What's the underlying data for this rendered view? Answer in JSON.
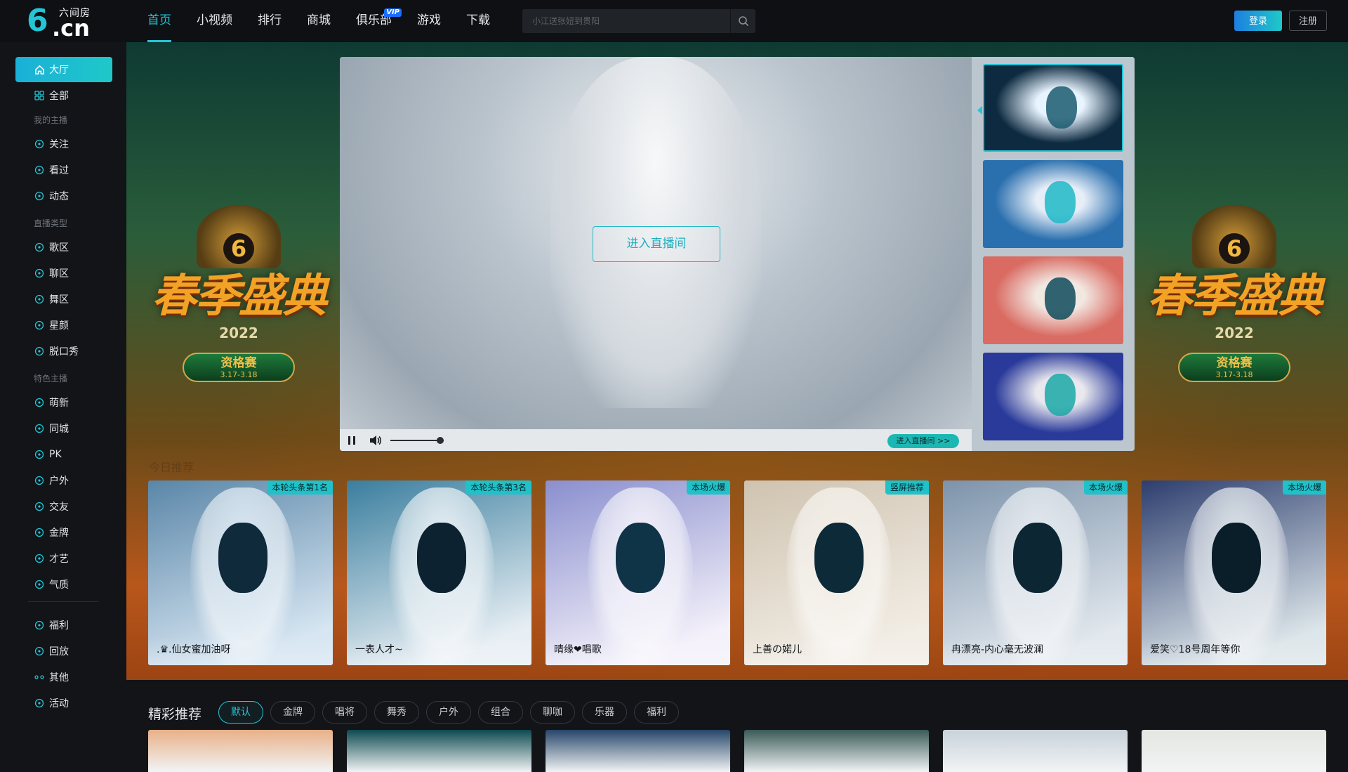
{
  "brand": {
    "glyph": "6",
    "domain": ".cn",
    "name": "六间房"
  },
  "nav": [
    {
      "label": "首页",
      "active": true
    },
    {
      "label": "小视频"
    },
    {
      "label": "排行"
    },
    {
      "label": "商城"
    },
    {
      "label": "俱乐部",
      "badge": "VIP"
    },
    {
      "label": "游戏"
    },
    {
      "label": "下载"
    }
  ],
  "search": {
    "placeholder": "小江送张妞到贵阳",
    "icon": "search-icon"
  },
  "auth": {
    "login": "登录",
    "register": "注册"
  },
  "sidebar": {
    "top": [
      {
        "label": "大厅",
        "icon": "home-icon",
        "active": true
      },
      {
        "label": "全部",
        "icon": "grid-icon"
      }
    ],
    "groups": [
      {
        "title": "我的主播",
        "items": [
          {
            "label": "关注",
            "icon": "heart-icon"
          },
          {
            "label": "看过",
            "icon": "clock-icon"
          },
          {
            "label": "动态",
            "icon": "chat-icon"
          }
        ]
      },
      {
        "title": "直播类型",
        "items": [
          {
            "label": "歌区",
            "icon": "music-icon"
          },
          {
            "label": "聊区",
            "icon": "bubble-icon"
          },
          {
            "label": "舞区",
            "icon": "dancer-icon"
          },
          {
            "label": "星颜",
            "icon": "mask-icon"
          },
          {
            "label": "脱口秀",
            "icon": "mic-icon"
          }
        ]
      },
      {
        "title": "特色主播",
        "items": [
          {
            "label": "萌新",
            "icon": "sprout-icon"
          },
          {
            "label": "同城",
            "icon": "location-icon"
          },
          {
            "label": "PK",
            "icon": "lightning-icon"
          },
          {
            "label": "户外",
            "icon": "mountain-icon"
          },
          {
            "label": "交友",
            "icon": "users-icon"
          },
          {
            "label": "金牌",
            "icon": "medal-icon"
          },
          {
            "label": "才艺",
            "icon": "palette-icon"
          },
          {
            "label": "气质",
            "icon": "shoe-icon"
          }
        ]
      }
    ],
    "bottom": [
      {
        "label": "福利",
        "icon": "gift-icon"
      },
      {
        "label": "回放",
        "icon": "replay-icon"
      },
      {
        "label": "其他",
        "icon": "dots-icon"
      },
      {
        "label": "活动",
        "icon": "star-icon"
      }
    ]
  },
  "banner": {
    "title": "春季盛典",
    "year": "2022",
    "stage": "资格赛",
    "dates": "3.17-3.18"
  },
  "player": {
    "enter_label": "进入直播间",
    "enter_small": "进入直播间 >>",
    "volume": 0.85,
    "thumbs": [
      {
        "colors": [
          "#0d2a40",
          "#e8f4ff",
          "#1a5a70"
        ],
        "selected": true
      },
      {
        "colors": [
          "#2a6fae",
          "#e6eef8",
          "#1fb9c8"
        ]
      },
      {
        "colors": [
          "#d96b62",
          "#f2e8e2",
          "#0e4a5a"
        ]
      },
      {
        "colors": [
          "#2a3a9a",
          "#e8e8ee",
          "#1aa8a6"
        ]
      }
    ]
  },
  "featured": {
    "section_label": "今日推荐",
    "cards": [
      {
        "badge": "本轮头条第1名",
        "name": ".♛.仙女蜜加油呀",
        "colors": [
          "#5a86a8",
          "#d7e6f2",
          "#0f2a3a"
        ]
      },
      {
        "badge": "本轮头条第3名",
        "name": "一表人才~",
        "colors": [
          "#3a7e9e",
          "#e8eff4",
          "#0c2230"
        ]
      },
      {
        "badge": "本场火爆",
        "name": "晴缘❤唱歌",
        "colors": [
          "#8a8fce",
          "#f4f1fa",
          "#0f3448"
        ]
      },
      {
        "badge": "竖屏推荐",
        "name": "上善の婼儿",
        "colors": [
          "#cfc3b0",
          "#f2ede5",
          "#0c2a38"
        ]
      },
      {
        "badge": "本场火爆",
        "name": "冉漂亮-内心毫无波澜",
        "colors": [
          "#7d93ab",
          "#e2e8ee",
          "#0c2634"
        ]
      },
      {
        "badge": "本场火爆",
        "name": "爱笑♡18号周年等你",
        "colors": [
          "#2d3e6e",
          "#dde6ea",
          "#0a1e2a"
        ]
      }
    ]
  },
  "recommend": {
    "title": "精彩推荐",
    "tabs": [
      {
        "label": "默认",
        "active": true
      },
      {
        "label": "金牌"
      },
      {
        "label": "唱将"
      },
      {
        "label": "舞秀"
      },
      {
        "label": "户外"
      },
      {
        "label": "组合"
      },
      {
        "label": "聊咖"
      },
      {
        "label": "乐器"
      },
      {
        "label": "福利"
      }
    ],
    "card_colors": [
      "#e8b088",
      "#0d4a50",
      "#27466a",
      "#3a5a58",
      "#c8d2da",
      "#e4e6e2"
    ]
  },
  "colors": {
    "accent": "#22c6d6",
    "topbar": "#0e1013",
    "sidebar": "#121417"
  }
}
